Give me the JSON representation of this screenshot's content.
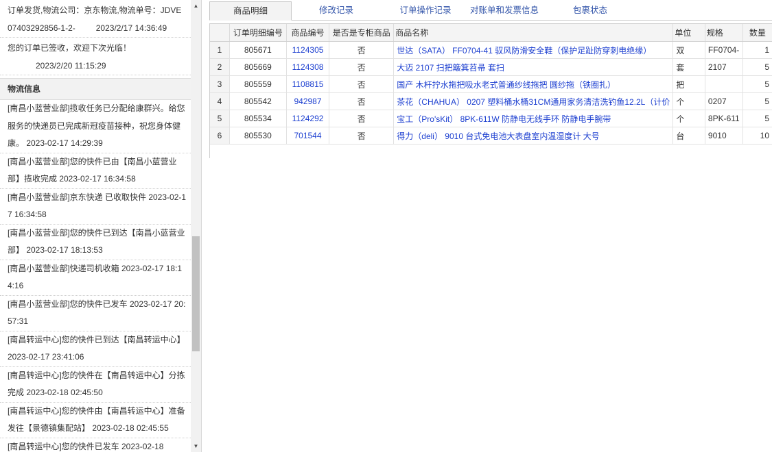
{
  "order_notes": [
    {
      "text": "订单发货,物流公司：京东物流,物流单号：JDVE07403292856-1-2-",
      "time": "2023/2/17 14:36:49"
    },
    {
      "text": "您的订单已签收，欢迎下次光临！",
      "time": "2023/2/20 11:15:29"
    }
  ],
  "logistics": {
    "title": "物流信息",
    "logs": [
      "[南昌小蓝营业部]揽收任务已分配给康群兴。给您服务的快递员已完成新冠疫苗接种，祝您身体健康。 2023-02-17 14:29:39",
      "[南昌小蓝营业部]您的快件已由【南昌小蓝营业部】揽收完成 2023-02-17 16:34:58",
      "[南昌小蓝营业部]京东快递 已收取快件 2023-02-17 16:34:58",
      "[南昌小蓝营业部]您的快件已到达【南昌小蓝营业部】 2023-02-17 18:13:53",
      "[南昌小蓝营业部]快递司机收箱 2023-02-17 18:14:16",
      "[南昌小蓝营业部]您的快件已发车 2023-02-17 20:57:31",
      "[南昌转运中心]您的快件已到达【南昌转运中心】 2023-02-17 23:41:06",
      "[南昌转运中心]您的快件在【南昌转运中心】分拣完成 2023-02-18 02:45:50",
      "[南昌转运中心]您的快件由【南昌转运中心】准备发往【景德镇集配站】 2023-02-18 02:45:55",
      "[南昌转运中心]您的快件已发车 2023-02-18"
    ]
  },
  "tabs": [
    "商品明细",
    "修改记录",
    "订单操作记录",
    "对账单和发票信息",
    "包裹状态"
  ],
  "table": {
    "headers": [
      "",
      "订单明细编号",
      "商品编号",
      "是否是专柜商品",
      "商品名称",
      "单位",
      "规格",
      "数量"
    ],
    "rows": [
      [
        "1",
        "805671",
        "1124305",
        "否",
        "世达（SATA） FF0704-41 驭风防滑安全鞋（保护足趾防穿刺电绝缘）",
        "双",
        "FF0704-",
        "1"
      ],
      [
        "2",
        "805669",
        "1124308",
        "否",
        "大迈 2107 扫把簸箕苕帚 套扫",
        "套",
        "2107",
        "5"
      ],
      [
        "3",
        "805559",
        "1108815",
        "否",
        "国产 木杆拧水拖把吸水老式普通纱线拖把 圆纱拖（铁圈扎）",
        "把",
        "",
        "5"
      ],
      [
        "4",
        "805542",
        "942987",
        "否",
        "茶花（CHAHUA） 0207 塑料桶水桶31CM通用家务清洁洗钓鱼12.2L（计价",
        "个",
        "0207",
        "5"
      ],
      [
        "5",
        "805534",
        "1124292",
        "否",
        "宝工（Pro'sKit） 8PK-611W 防静电无线手环 防静电手腕带",
        "个",
        "8PK-611",
        "5"
      ],
      [
        "6",
        "805530",
        "701544",
        "否",
        "得力（deli） 9010 台式免电池大表盘室内温湿度计 大号",
        "台",
        "9010",
        "10"
      ]
    ]
  }
}
